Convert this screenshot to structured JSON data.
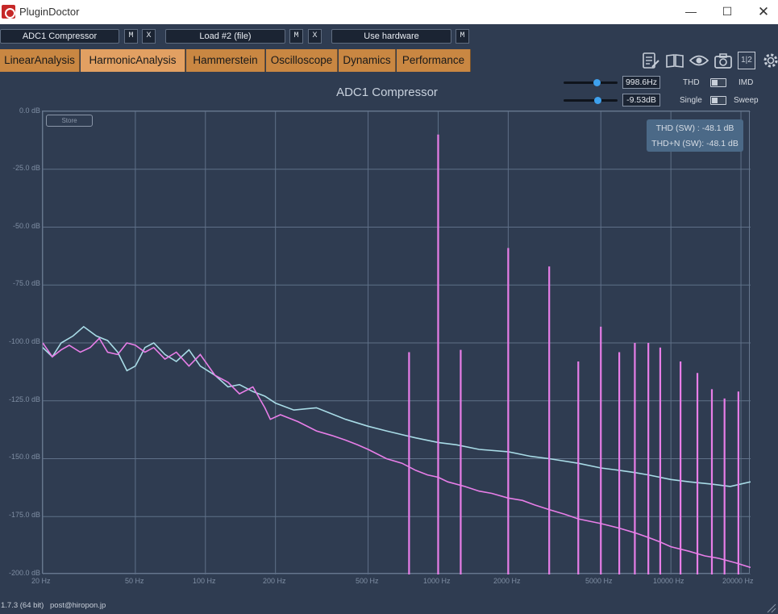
{
  "window": {
    "title": "PluginDoctor",
    "minimize_glyph": "—",
    "maximize_glyph": "☐",
    "close_glyph": "✕"
  },
  "plugin_bar": {
    "slot1_name": "ADC1 Compressor",
    "slot2_name": "Load #2 (file)",
    "slot3_name": "Use hardware",
    "menu_label": "M",
    "remove_label": "X"
  },
  "tabs": {
    "linear": "LinearAnalysis",
    "harmonic": "HarmonicAnalysis",
    "hammerstein": "Hammerstein",
    "oscilloscope": "Oscilloscope",
    "dynamics": "Dynamics",
    "performance": "Performance"
  },
  "toolbar": {
    "layout_label": "1|2",
    "icons": [
      "notes-icon",
      "book-icon",
      "eye-icon",
      "camera-icon",
      "layout-1-2-icon",
      "gear-icon"
    ]
  },
  "controls": {
    "frequency_value": "998.6Hz",
    "level_value": "-9.53dB",
    "frequency_slider_position": 0.63,
    "level_slider_position": 0.65,
    "thd_label": "THD",
    "imd_label": "IMD",
    "single_label": "Single",
    "sweep_label": "Sweep"
  },
  "plot": {
    "store_label": "Store",
    "thd_readout": "THD (SW) : -48.1 dB",
    "thdn_readout": "THD+N (SW): -48.1 dB"
  },
  "footer": {
    "version": "1.7.3 (64 bit)",
    "contact": "post@hiropon.jp"
  },
  "colors": {
    "background": "#2f3c51",
    "tab": "#c98742",
    "tab_active": "#e2a062",
    "pink_trace": "#e87ee8",
    "cyan_trace": "#a8dbe6",
    "grid": "#5f7088"
  },
  "chart_data": {
    "type": "line",
    "title": "ADC1 Compressor",
    "xlabel": "",
    "ylabel": "",
    "x_scale": "log",
    "xlim": [
      20,
      22000
    ],
    "ylim": [
      -200,
      0
    ],
    "x_ticks": [
      20,
      50,
      100,
      200,
      500,
      1000,
      2000,
      5000,
      10000,
      20000
    ],
    "x_tick_labels": [
      "20 Hz",
      "50 Hz",
      "100 Hz",
      "200 Hz",
      "500 Hz",
      "1000 Hz",
      "2000 Hz",
      "5000 Hz",
      "10000 Hz",
      "20000 Hz"
    ],
    "y_ticks": [
      0,
      -25,
      -50,
      -75,
      -100,
      -125,
      -150,
      -175,
      -200
    ],
    "y_tick_labels": [
      "0.0 dB",
      "-25.0 dB",
      "-50.0 dB",
      "-75.0 dB",
      "-100.0 dB",
      "-125.0 dB",
      "-150.0 dB",
      "-175.0 dB",
      "-200.0 dB"
    ],
    "grid": true,
    "series": [
      {
        "color": "#a8dbe6",
        "x": [
          20,
          22,
          24,
          27,
          30,
          34,
          38,
          42,
          46,
          50,
          55,
          60,
          67,
          75,
          85,
          95,
          110,
          125,
          140,
          160,
          180,
          200,
          240,
          300,
          400,
          500,
          600,
          800,
          1000,
          1200,
          1500,
          2000,
          2500,
          3000,
          4000,
          5000,
          6000,
          7000,
          8000,
          10000,
          12000,
          15000,
          18000,
          22000
        ],
        "y": [
          -102,
          -106,
          -100,
          -97,
          -93,
          -97,
          -99,
          -104,
          -112,
          -110,
          -102,
          -100,
          -105,
          -108,
          -103,
          -110,
          -114,
          -119,
          -118,
          -121,
          -123,
          -126,
          -129,
          -128,
          -133,
          -136,
          -138,
          -141,
          -143,
          -144,
          -146,
          -147,
          -149,
          -150,
          -152,
          -154,
          -155,
          -156,
          -157,
          -159,
          -160,
          -161,
          -162,
          -160
        ]
      },
      {
        "color": "#e87ee8",
        "x": [
          20,
          22,
          24,
          26,
          29,
          32,
          35,
          38,
          42,
          46,
          50,
          55,
          60,
          67,
          75,
          85,
          95,
          110,
          125,
          140,
          160,
          180,
          190,
          210,
          250,
          300,
          350,
          400,
          450,
          500,
          600,
          700,
          800,
          900,
          1000,
          1100,
          1300,
          1500,
          1700,
          2000,
          2300,
          2600,
          3000,
          3500,
          4000,
          5000,
          6000,
          7000,
          8000,
          9000,
          10000,
          12000,
          14000,
          16000,
          19000,
          22000
        ],
        "y": [
          -100,
          -106,
          -103,
          -101,
          -104,
          -102,
          -98,
          -104,
          -105,
          -100,
          -101,
          -104,
          -102,
          -107,
          -104,
          -110,
          -105,
          -114,
          -117,
          -122,
          -119,
          -128,
          -133,
          -131,
          -134,
          -138,
          -140,
          -142,
          -144,
          -146,
          -150,
          -152,
          -155,
          -157,
          -158,
          -160,
          -162,
          -164,
          -165,
          -167,
          -168,
          -170,
          -172,
          -174,
          -176,
          -178,
          -180,
          -182,
          -184,
          -186,
          -188,
          -190,
          -192,
          -193,
          -195,
          -197
        ]
      }
    ],
    "harmonic_peaks": [
      {
        "x": 1000,
        "y": -10
      },
      {
        "x": 2000,
        "y": -59
      },
      {
        "x": 3000,
        "y": -67
      },
      {
        "x": 5000,
        "y": -93
      },
      {
        "x": 750,
        "y": -104
      },
      {
        "x": 1250,
        "y": -103
      },
      {
        "x": 4000,
        "y": -108
      },
      {
        "x": 6000,
        "y": -104
      },
      {
        "x": 7000,
        "y": -100
      },
      {
        "x": 8000,
        "y": -100
      },
      {
        "x": 9000,
        "y": -102
      },
      {
        "x": 11000,
        "y": -108
      },
      {
        "x": 13000,
        "y": -113
      },
      {
        "x": 15000,
        "y": -120
      },
      {
        "x": 17000,
        "y": -124
      },
      {
        "x": 19500,
        "y": -121
      }
    ]
  }
}
